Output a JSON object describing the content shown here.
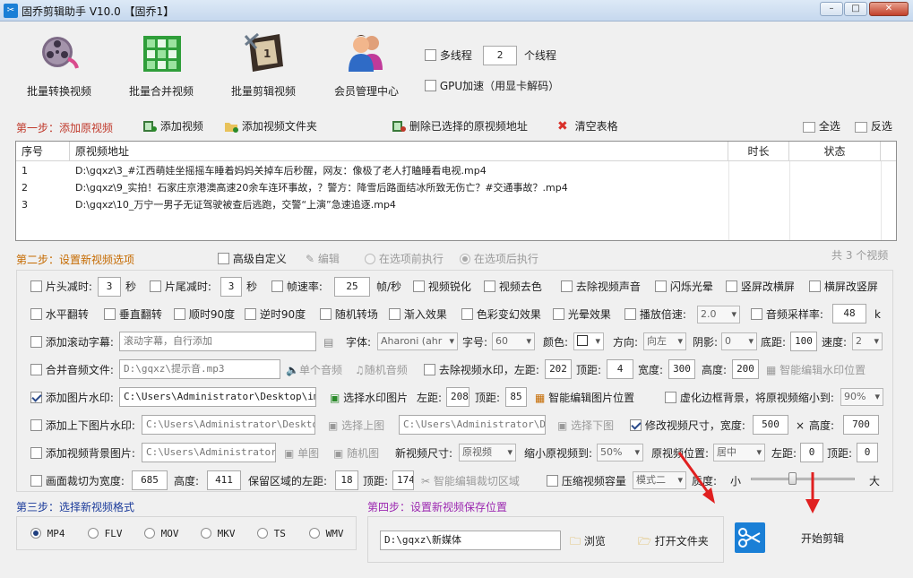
{
  "window": {
    "title": "固乔剪辑助手 V10.0  【固乔1】",
    "min": "–",
    "max": "□",
    "close": "✕"
  },
  "toolbar": [
    {
      "label": "批量转换视频",
      "icon": "film-reel-icon"
    },
    {
      "label": "批量合并视频",
      "icon": "merge-grid-icon"
    },
    {
      "label": "批量剪辑视频",
      "icon": "film-strip-icon"
    },
    {
      "label": "会员管理中心",
      "icon": "users-icon"
    }
  ],
  "threads": {
    "multi_label": "多线程",
    "multi_checked": false,
    "count": "2",
    "unit": "个线程",
    "gpu_label": "GPU加速（用显卡解码）",
    "gpu_checked": false
  },
  "step1": {
    "title": "第一步：添加原视频",
    "add_video": "添加视频",
    "add_folder": "添加视频文件夹",
    "delete_selected": "删除已选择的原视频地址",
    "clear_table": "清空表格",
    "select_all": "全选",
    "invert": "反选"
  },
  "table": {
    "headers": [
      "序号",
      "原视频地址",
      "时长",
      "状态"
    ],
    "rows": [
      {
        "no": "1",
        "path": "D:\\gqxz\\3_#江西萌娃坐摇摇车睡着妈妈关掉车后秒醒，网友：像极了老人打瞌睡看电视.mp4",
        "dur": "",
        "status": ""
      },
      {
        "no": "2",
        "path": "D:\\gqxz\\9_实拍！石家庄京港澳高速20余车连环事故，？警方：降雪后路面结冰所致无伤亡？#交通事故？.mp4",
        "dur": "",
        "status": ""
      },
      {
        "no": "3",
        "path": "D:\\gqxz\\10_万宁一男子无证驾驶被查后逃跑，交警“上演”急速追逐.mp4",
        "dur": "",
        "status": ""
      }
    ]
  },
  "step2": {
    "title": "第二步：设置新视频选项",
    "advanced": "高级自定义",
    "edit": "编辑",
    "before": "在选项前执行",
    "after": "在选项后执行",
    "total": "共 3 个视频"
  },
  "opts": {
    "head_cut": "片头减时:",
    "head_val": "3",
    "sec": "秒",
    "tail_cut": "片尾减时:",
    "tail_val": "3",
    "fps": "帧速率:",
    "fps_val": "25",
    "fps_unit": "帧/秒",
    "sharpen": "视频锐化",
    "decolor": "视频去色",
    "remove_audio": "去除视频声音",
    "flash": "闪烁光晕",
    "v2h": "竖屏改横屏",
    "h2v": "横屏改竖屏",
    "hflip": "水平翻转",
    "vflip": "垂直翻转",
    "cw90": "顺时90度",
    "ccw90": "逆时90度",
    "random_trans": "随机转场",
    "fade_in": "渐入效果",
    "color_change": "色彩变幻效果",
    "halo": "光晕效果",
    "speed_label": "播放倍速:",
    "speed_val": "2.0",
    "sample_label": "音频采样率:",
    "sample_val": "48",
    "sample_unit": "k",
    "scroll_sub": "添加滚动字幕:",
    "scroll_placeholder": "滚动字幕，自行添加",
    "font_label": "字体:",
    "font_val": "Aharoni (ahr",
    "size_label": "字号:",
    "size_val": "60",
    "color_label": "颜色:",
    "dir_label": "方向:",
    "dir_val": "向左",
    "shadow_label": "阴影:",
    "shadow_val": "0",
    "bottom_label": "底距:",
    "bottom_val": "100",
    "speed2_label": "速度:",
    "speed2_val": "2",
    "merge_audio": "合并音频文件:",
    "audio_path": "D:\\gqxz\\提示音.mp3",
    "single_audio": "单个音频",
    "random_audio": "随机音频",
    "remove_wm": "去除视频水印，左距:",
    "wm_left": "202",
    "top_label": "顶距:",
    "wm_top": "4",
    "width_label": "宽度:",
    "wm_w": "300",
    "height_label": "高度:",
    "wm_h": "200",
    "smart_wm": "智能编辑水印位置",
    "img_wm": "添加图片水印:",
    "img_wm_path": "C:\\Users\\Administrator\\Desktop\\img-q",
    "choose_img_wm": "选择水印图片",
    "left_label": "左距:",
    "img_left": "208",
    "img_top": "85",
    "smart_img": "智能编辑图片位置",
    "blur_bg": "虚化边框背景，将原视频缩小到:",
    "blur_val": "90%",
    "tb_wm": "添加上下图片水印:",
    "tb_path1": "C:\\Users\\Administrator\\Desktop\\i",
    "choose_top": "选择上图",
    "tb_path2": "C:\\Users\\Administrator\\Desk",
    "choose_bottom": "选择下图",
    "resize": "修改视频尺寸，宽度:",
    "resize_w": "500",
    "x": "×",
    "height2_label": "高度:",
    "resize_h": "700",
    "bg_img": "添加视频背景图片:",
    "bg_path": "C:\\Users\\Administrator\\D",
    "single_img": "单图",
    "random_img": "随机图",
    "new_size_label": "新视频尺寸:",
    "new_size_val": "原视频",
    "shrink_label": "缩小原视频到:",
    "shrink_val": "50%",
    "pos_label": "原视频位置:",
    "pos_val": "居中",
    "pos_left": "0",
    "pos_top": "0",
    "crop": "画面裁切为宽度:",
    "crop_w": "685",
    "crop_h": "411",
    "keep_left": "保留区域的左距:",
    "crop_left": "18",
    "crop_top": "174",
    "smart_crop": "智能编辑裁切区域",
    "compress": "压缩视频容量",
    "mode_val": "模式二",
    "quality_label": "质度:",
    "small": "小",
    "big": "大",
    "quality_level": 0.4
  },
  "step3": {
    "title": "第三步：选择新视频格式",
    "formats": [
      {
        "label": "MP4",
        "on": true
      },
      {
        "label": "FLV",
        "on": false
      },
      {
        "label": "MOV",
        "on": false
      },
      {
        "label": "MKV",
        "on": false
      },
      {
        "label": "TS",
        "on": false
      },
      {
        "label": "WMV",
        "on": false
      }
    ]
  },
  "step4": {
    "title": "第四步：设置新视频保存位置",
    "path": "D:\\gqxz\\新媒体",
    "browse": "浏览",
    "open_folder": "打开文件夹"
  },
  "start": {
    "label": "开始剪辑"
  },
  "colors": {
    "step_red": "#c0392b",
    "step_orange": "#c56a00",
    "step_purple": "#9b27b0",
    "accent_blue": "#1a7fd6",
    "arrow_red": "#e02020"
  }
}
